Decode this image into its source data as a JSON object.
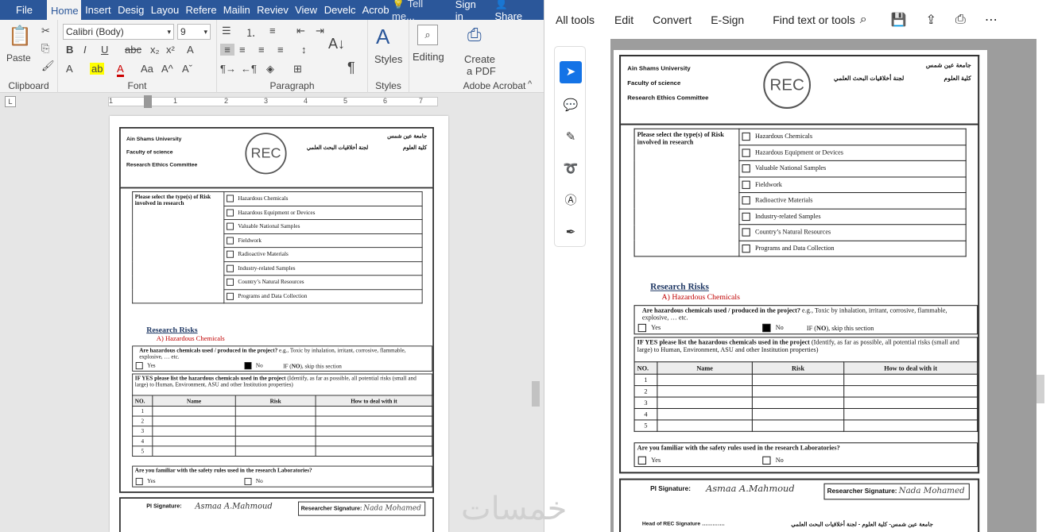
{
  "word": {
    "tabs": [
      "File",
      "Home",
      "Insert",
      "Desig",
      "Layou",
      "Refere",
      "Mailin",
      "Reviev",
      "View",
      "Develc",
      "Acrob"
    ],
    "tellme": "Tell me...",
    "signin": "Sign in",
    "share": "Share",
    "font_name": "Calibri (Body)",
    "font_size": "9",
    "groups": {
      "clipboard": "Clipboard",
      "font": "Font",
      "paragraph": "Paragraph",
      "styles": "Styles",
      "adobe": "Adobe Acrobat"
    },
    "paste": "Paste",
    "styles_btn": "Styles",
    "editing_btn": "Editing",
    "create_pdf_1": "Create",
    "create_pdf_2": "a PDF",
    "ruler_numbers": [
      "1",
      "1",
      "2",
      "3",
      "4",
      "5",
      "6",
      "7"
    ]
  },
  "acrobat": {
    "toolbar": {
      "all_tools": "All tools",
      "edit": "Edit",
      "convert": "Convert",
      "esign": "E-Sign",
      "find": "Find text or tools"
    }
  },
  "form": {
    "university_en": "Ain Shams University",
    "faculty_en": "Faculty of science",
    "committee_en": "Research  Ethics  Committee",
    "university_ar": "جامعة عين شمس",
    "faculty_ar": "كلية العلوم",
    "committee_ar": "لجنة أخلاقيات البحث العلمي",
    "seal_text": "REC",
    "risk_type_label": "Please select the type(s) of Risk involved in research",
    "risk_types": [
      "Hazardous Chemicals",
      "Hazardous Equipment or Devices",
      "Valuable National Samples",
      "Fieldwork",
      "Radioactive Materials",
      "Industry-related Samples",
      "Country’s Natural Resources",
      "Programs and Data Collection"
    ],
    "research_risks": "Research Risks",
    "hazardous_heading": "A) Hazardous Chemicals",
    "q_hazardous": "Are hazardous chemicals used / produced in the project?",
    "q_hazardous_eg": "e.g., Toxic by inhalation, irritant, corrosive, flammable, explosive, … etc.",
    "yes": "Yes",
    "no": "No",
    "if_no_prefix": "IF (",
    "if_no_bold": "NO",
    "if_no_suffix": "), skip this section",
    "if_yes_bold": "IF YES please list the hazardous chemicals used in the project",
    "if_yes_rest": "(Identify, as far as possible, all potential risks (small and large) to Human, Environment, ASU and other Institution properties)",
    "table_headers": [
      "NO.",
      "Name",
      "Risk",
      "How to deal with it"
    ],
    "table_rows": [
      "1",
      "2",
      "3",
      "4",
      "5"
    ],
    "q_safety": "Are you familiar with the safety rules used in the research Laboratories?",
    "pi_signature": "PI Signature:",
    "pi_sig_value": "Asmaa A.Mahmoud",
    "researcher_signature": "Researcher Signature:",
    "researcher_sig_value": "Nada Mohamed",
    "head_rec": "Head of REC Signature ………….",
    "footer_ar": "جامعة عين شمس- كلية العلوم - لجنة أخلاقيات البحث العلمي"
  },
  "watermark": "خمسات"
}
